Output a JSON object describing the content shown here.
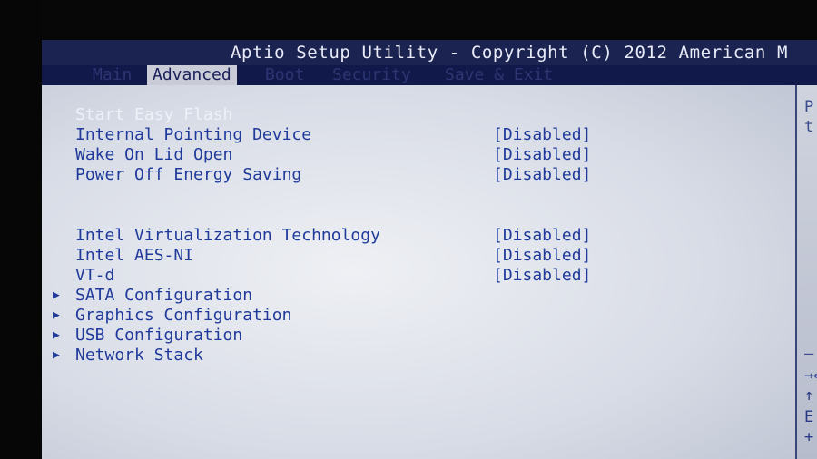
{
  "title": "Aptio Setup Utility - Copyright (C) 2012 American M",
  "tabs": [
    {
      "label": "Main"
    },
    {
      "label": "Advanced"
    },
    {
      "label": "Boot"
    },
    {
      "label": "Security"
    },
    {
      "label": "Save & Exit"
    }
  ],
  "items": [
    {
      "label": "Start Easy Flash",
      "value": ""
    },
    {
      "label": "Internal Pointing Device",
      "value": "[Disabled]"
    },
    {
      "label": "Wake On Lid Open",
      "value": "[Disabled]"
    },
    {
      "label": "Power Off Energy Saving",
      "value": "[Disabled]"
    },
    {
      "label": "Intel Virtualization Technology",
      "value": "[Disabled]"
    },
    {
      "label": "Intel AES-NI",
      "value": "[Disabled]"
    },
    {
      "label": "VT-d",
      "value": "[Disabled]"
    }
  ],
  "submenus": [
    {
      "label": "SATA Configuration"
    },
    {
      "label": "Graphics Configuration"
    },
    {
      "label": "USB Configuration"
    },
    {
      "label": "Network Stack"
    }
  ],
  "help_panel": {
    "text_lines": [
      "P",
      "t"
    ],
    "key_lines": [
      "→←",
      "↑",
      "E",
      "+"
    ],
    "separator": "—"
  },
  "icons": {
    "submenu_arrow": "right-triangle-icon"
  }
}
